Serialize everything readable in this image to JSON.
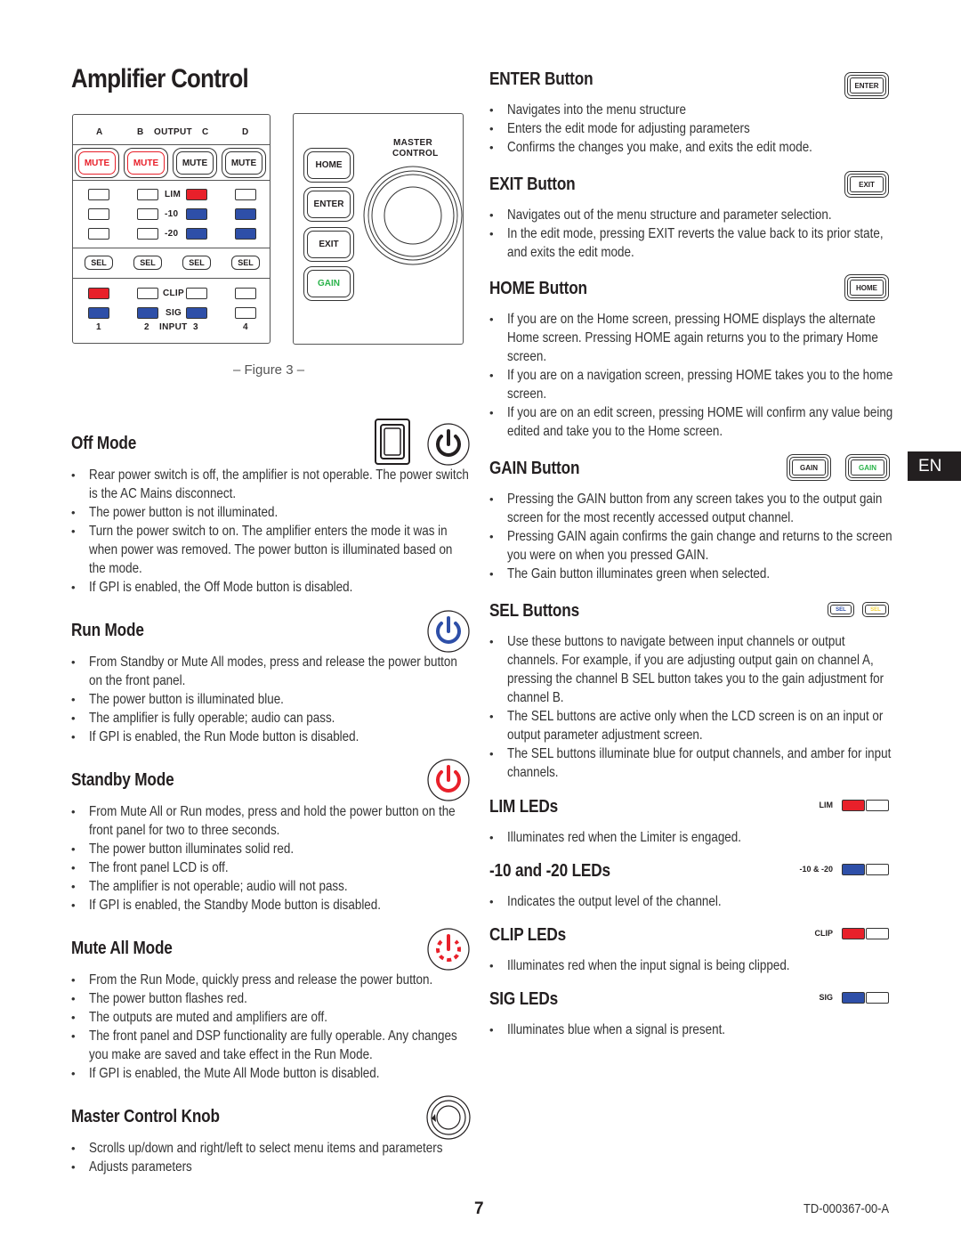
{
  "page": {
    "title": "Amplifier Control",
    "page_number": "7",
    "doc_id": "TD-000367-00-A",
    "language_tab": "EN",
    "figure_caption": "– Figure 3 –"
  },
  "figure": {
    "output_header": [
      "A",
      "B",
      "OUTPUT",
      "C",
      "D"
    ],
    "mute_buttons": [
      {
        "label": "MUTE",
        "active": true
      },
      {
        "label": "MUTE",
        "active": true
      },
      {
        "label": "MUTE",
        "active": false
      },
      {
        "label": "MUTE",
        "active": false
      }
    ],
    "led_labels": {
      "lim": "LIM",
      "m10": "-10",
      "m20": "-20",
      "clip": "CLIP",
      "sig": "SIG"
    },
    "sel_label": "SEL",
    "input_footer": [
      "1",
      "2",
      "INPUT",
      "3",
      "4"
    ],
    "master_control_label": [
      "MASTER",
      "CONTROL"
    ],
    "control_buttons": [
      "HOME",
      "ENTER",
      "EXIT",
      "GAIN"
    ],
    "colors": {
      "red": "#e8202a",
      "blue": "#2e4fa8",
      "green": "#2ab34a",
      "amber": "#f5d33b"
    }
  },
  "left_sections": [
    {
      "heading": "Off Mode",
      "bullets": [
        "Rear power switch is off, the amplifier is not operable. The power switch is the AC Mains disconnect.",
        "The power button is not illuminated.",
        "Turn the power switch to on. The amplifier enters the mode it was in when power was removed. The power button is illuminated based on the mode.",
        "If GPI is enabled, the Off Mode button is disabled."
      ]
    },
    {
      "heading": "Run Mode",
      "bullets": [
        "From Standby or Mute All modes, press and release the power button on the front panel.",
        "The power button is illuminated blue.",
        "The amplifier is fully operable; audio can pass.",
        "If GPI is enabled, the Run Mode button is disabled."
      ]
    },
    {
      "heading": "Standby Mode",
      "bullets": [
        "From Mute All or Run modes, press and hold the power button on the front panel for two to three seconds.",
        "The power button illuminates solid red.",
        "The front panel LCD is off.",
        "The amplifier is not operable; audio will not pass.",
        "If GPI is enabled, the Standby Mode button is disabled."
      ]
    },
    {
      "heading": "Mute All Mode",
      "bullets": [
        "From the Run Mode, quickly press and release the power button.",
        "The power button flashes red.",
        "The outputs are muted and amplifiers are off.",
        "The front panel and DSP functionality are fully operable. Any changes you make are saved and take effect in the Run Mode.",
        "If GPI is enabled, the Mute All Mode button is disabled."
      ]
    },
    {
      "heading": "Master Control Knob",
      "bullets": [
        "Scrolls up/down and right/left to select menu items and parameters",
        "Adjusts parameters"
      ]
    }
  ],
  "right_sections": [
    {
      "heading": "ENTER Button",
      "icon_labels": [
        "ENTER"
      ],
      "bullets": [
        "Navigates into the menu structure",
        "Enters the edit mode for adjusting parameters",
        "Confirms the changes you make, and exits the edit mode."
      ]
    },
    {
      "heading": "EXIT Button",
      "icon_labels": [
        "EXIT"
      ],
      "bullets": [
        "Navigates out of the menu structure and parameter selection.",
        "In the edit mode, pressing EXIT reverts the value back to its prior state, and exits the edit mode."
      ]
    },
    {
      "heading": "HOME Button",
      "icon_labels": [
        "HOME"
      ],
      "bullets": [
        "If you are on the Home screen, pressing HOME displays the alternate Home screen.  Pressing HOME again returns you to the primary Home screen.",
        "If you are on a navigation screen, pressing HOME takes you to the home screen.",
        "If you are on an edit screen, pressing HOME will confirm any value being edited and take you to the Home screen."
      ]
    },
    {
      "heading": "GAIN Button",
      "icon_labels": [
        "GAIN",
        "GAIN"
      ],
      "bullets": [
        "Pressing the GAIN button from any screen takes you to the output gain screen for the most recently accessed output channel.",
        "Pressing GAIN again confirms the gain change and returns to the screen you were on when you pressed GAIN.",
        "The Gain button illuminates green when selected."
      ]
    },
    {
      "heading": "SEL Buttons",
      "icon_labels": [
        "SEL",
        "SEL"
      ],
      "bullets": [
        "Use these buttons to navigate between input channels or output channels. For example, if you are adjusting output gain on channel A, pressing the channel B SEL button takes you to the gain adjustment for channel B.",
        "The SEL buttons are active only when the LCD screen is on an input or output parameter adjustment screen.",
        "The SEL buttons illuminate blue for output channels, and amber for input channels."
      ]
    },
    {
      "heading": "LIM LEDs",
      "icon_labels": [
        "LIM"
      ],
      "bullets": [
        "Illuminates red when the Limiter is engaged."
      ]
    },
    {
      "heading": "-10 and -20 LEDs",
      "icon_labels": [
        "-10 & -20"
      ],
      "bullets": [
        "Indicates the output level of the channel."
      ]
    },
    {
      "heading": "CLIP LEDs",
      "icon_labels": [
        "CLIP"
      ],
      "bullets": [
        "Illuminates red when the input signal is being clipped."
      ]
    },
    {
      "heading": "SIG LEDs",
      "icon_labels": [
        "SIG"
      ],
      "bullets": [
        "Illuminates blue when a signal is present."
      ]
    }
  ]
}
